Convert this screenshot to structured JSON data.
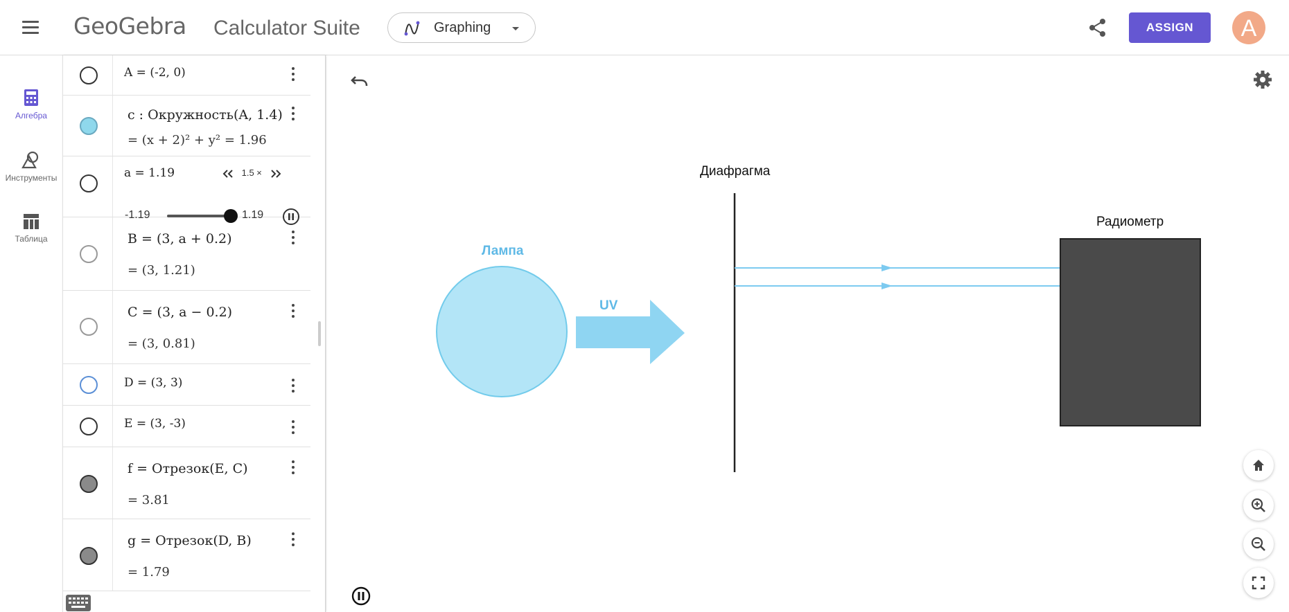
{
  "header": {
    "logo_text": "GeoGebra",
    "app_title": "Calculator Suite",
    "app_switcher_label": "Graphing",
    "assign_label": "ASSIGN",
    "avatar_letter": "A",
    "accent_color": "#6557d2"
  },
  "rail": {
    "items": [
      {
        "label": "Алгебра",
        "icon": "calculator-icon",
        "active": true
      },
      {
        "label": "Инструменты",
        "icon": "tools-shapes-icon",
        "active": false
      },
      {
        "label": "Таблица",
        "icon": "table-icon",
        "active": false
      }
    ]
  },
  "algebra": {
    "rows": [
      {
        "expr": "A = (-2, 0)",
        "marble": "empty"
      },
      {
        "expr": "c : Окружность(A, 1.4)",
        "output": "= (x + 2)² + y² = 1.96",
        "marble": "cyan",
        "color": "#8fd8ec"
      },
      {
        "expr": "a = 1.19",
        "marble": "empty",
        "slider": {
          "min_label": "-1.19",
          "max_label": "1.19",
          "speed_label": "1.5 ×",
          "value_fraction": 1.0
        }
      },
      {
        "expr": "B = (3, a + 0.2)",
        "output": "= (3, 1.21)",
        "marble": "light"
      },
      {
        "expr": "C = (3, a − 0.2)",
        "output": "= (3, 0.81)",
        "marble": "light"
      },
      {
        "expr": "D = (3, 3)",
        "marble": "blue"
      },
      {
        "expr": "E = (3, -3)",
        "marble": "empty"
      },
      {
        "expr": "f = Отрезок(E, C)",
        "output": "= 3.81",
        "marble": "filled"
      },
      {
        "expr": "g = Отрезок(D, B)",
        "output": "= 1.79",
        "marble": "filled"
      }
    ]
  },
  "graphics": {
    "label_lamp": "Лампа",
    "label_uv": "UV",
    "label_diaphragm": "Диафрагма",
    "label_radiometer": "Радиометр",
    "colors": {
      "lamp_fill": "#b3e5f7",
      "lamp_stroke": "#72cbeb",
      "uv_arrow": "#8fd5f2",
      "beam": "#7ccaf0",
      "radiometer_fill": "#4a4a4a",
      "radiometer_stroke": "#222222"
    }
  }
}
